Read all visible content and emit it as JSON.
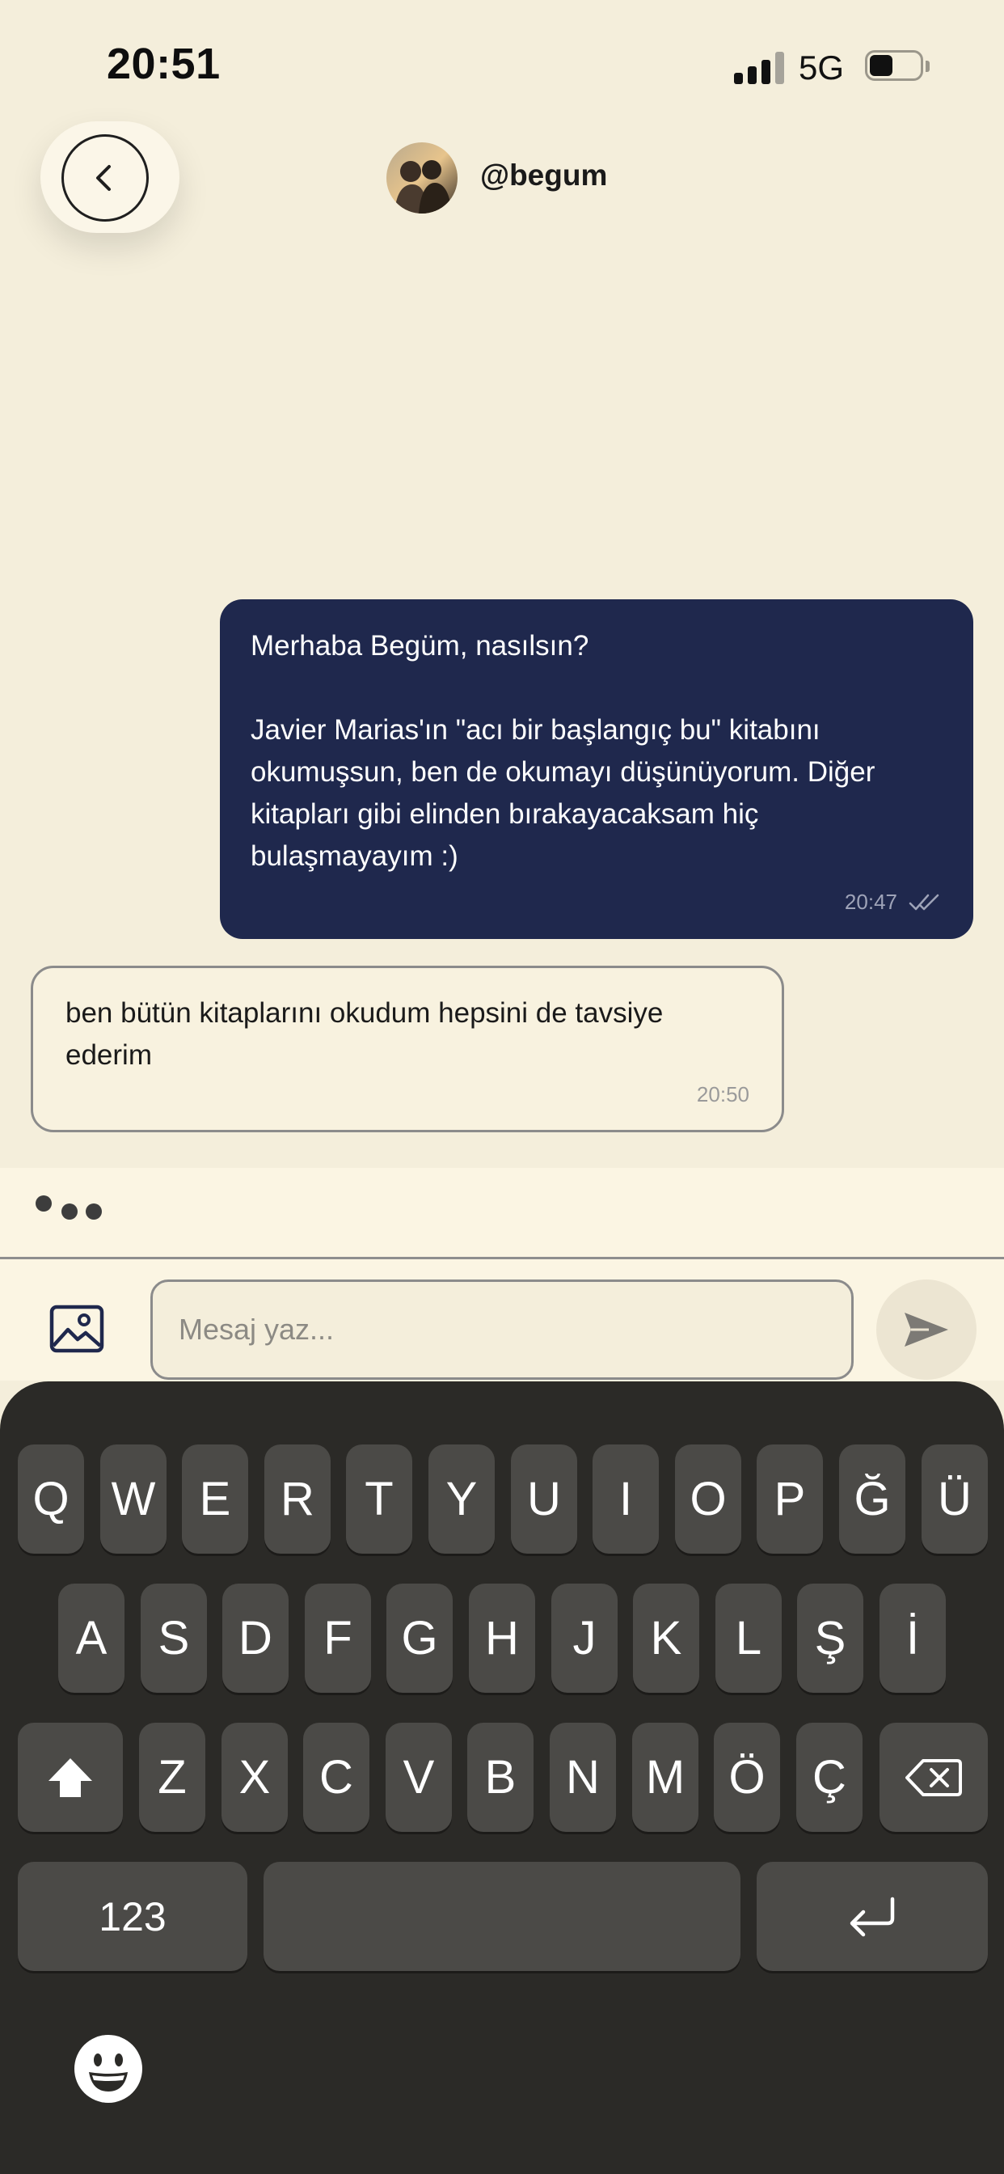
{
  "status_bar": {
    "time": "20:51",
    "network": "5G",
    "signal_bars_filled": 3,
    "signal_bars_total": 4,
    "battery_icon": "battery-icon"
  },
  "header": {
    "back_icon": "chevron-left-icon",
    "username": "@begum"
  },
  "messages": [
    {
      "direction": "outgoing",
      "text": "Merhaba Begüm, nasılsın?\n\nJavier Marias'ın \"acı bir başlangıç bu\" kitabını okumuşsun, ben de okumayı düşünüyorum. Diğer kitapları gibi elinden bırakayacaksam hiç bulaşmayayım :)",
      "time": "20:47",
      "read_icon": "double-check-icon"
    },
    {
      "direction": "incoming",
      "text": "ben bütün kitaplarını okudum hepsini de tavsiye ederim",
      "time": "20:50"
    }
  ],
  "composer": {
    "image_icon": "image-icon",
    "placeholder": "Mesaj yaz...",
    "value": "",
    "send_icon": "send-icon"
  },
  "keyboard": {
    "row1": [
      "Q",
      "W",
      "E",
      "R",
      "T",
      "Y",
      "U",
      "I",
      "O",
      "P",
      "Ğ",
      "Ü"
    ],
    "row2": [
      "A",
      "S",
      "D",
      "F",
      "G",
      "H",
      "J",
      "K",
      "L",
      "Ş",
      "İ"
    ],
    "row3": [
      "Z",
      "X",
      "C",
      "V",
      "B",
      "N",
      "M",
      "Ö",
      "Ç"
    ],
    "numbers_label": "123",
    "shift_icon": "shift-icon",
    "backspace_icon": "backspace-icon",
    "return_icon": "return-icon",
    "emoji_icon": "emoji-icon"
  },
  "colors": {
    "background": "#f4eedb",
    "outgoing_bubble": "#1f284d",
    "incoming_bubble": "#f8f2df",
    "keyboard": "#2b2a27",
    "key": "#4b4a47"
  }
}
